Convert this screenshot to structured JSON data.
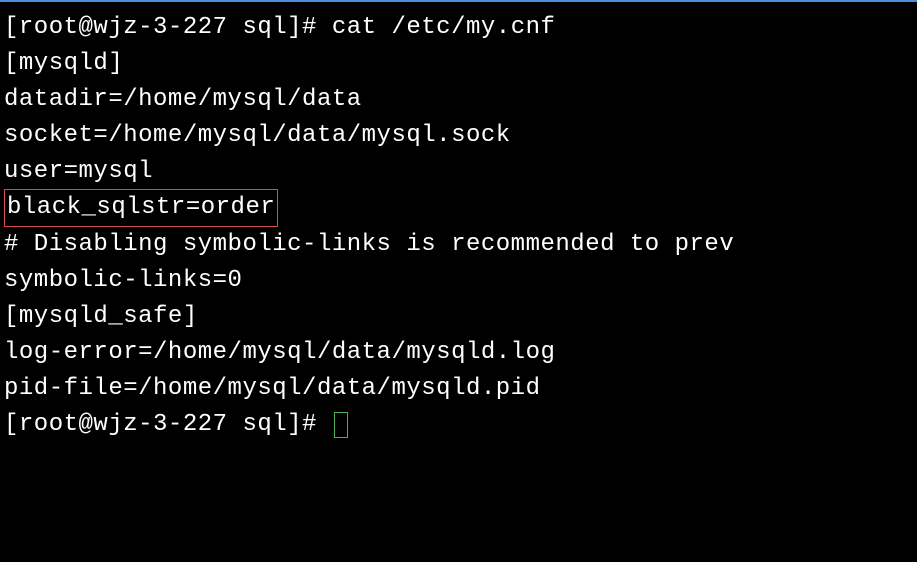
{
  "terminal": {
    "prompt1": "[root@wjz-3-227 sql]# ",
    "command1": "cat /etc/my.cnf",
    "lines": {
      "l1": "[mysqld]",
      "l2": "datadir=/home/mysql/data",
      "l3": "socket=/home/mysql/data/mysql.sock",
      "l4": "user=mysql",
      "l5": "black_sqlstr=order",
      "l6": "# Disabling symbolic-links is recommended to prev",
      "l7": "symbolic-links=0",
      "l8": "",
      "l9": "[mysqld_safe]",
      "l10": "log-error=/home/mysql/data/mysqld.log",
      "l11": "pid-file=/home/mysql/data/mysqld.pid"
    },
    "prompt2": "[root@wjz-3-227 sql]# "
  }
}
